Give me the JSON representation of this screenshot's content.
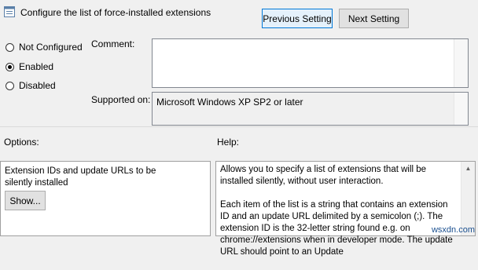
{
  "window": {
    "title": "Configure the list of force-installed extensions"
  },
  "toolbar": {
    "previous_label": "Previous Setting",
    "next_label": "Next Setting"
  },
  "state": {
    "options": [
      {
        "label": "Not Configured",
        "checked": false
      },
      {
        "label": "Enabled",
        "checked": true
      },
      {
        "label": "Disabled",
        "checked": false
      }
    ]
  },
  "comment": {
    "label": "Comment:",
    "value": ""
  },
  "supported": {
    "label": "Supported on:",
    "value": "Microsoft Windows XP SP2 or later"
  },
  "options_panel": {
    "label": "Options:",
    "description": "Extension IDs and update URLs to be silently installed",
    "show_label": "Show..."
  },
  "help_panel": {
    "label": "Help:",
    "paragraph1": "Allows you to specify a list of extensions that will be installed silently, without user interaction.",
    "paragraph2": "Each item of the list is a string that contains an extension ID and an update URL delimited by a semicolon (;). The extension ID is the 32-letter string found e.g. on chrome://extensions when in developer mode. The update URL should point to an Update"
  },
  "watermark": "wsxdn.com"
}
